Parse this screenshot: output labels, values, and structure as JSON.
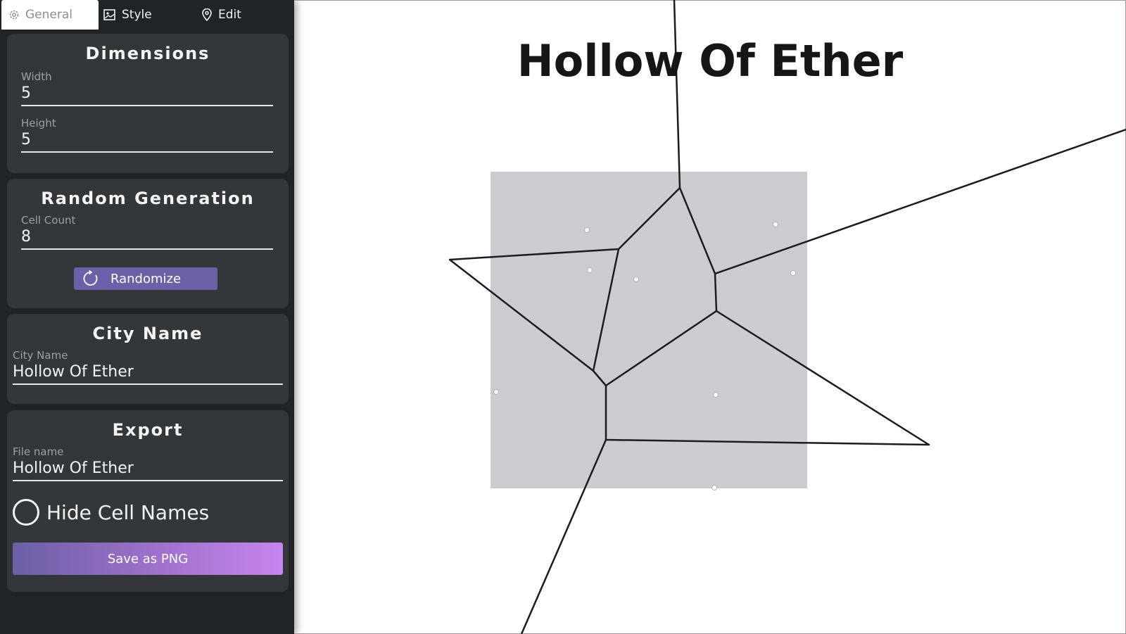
{
  "tabs": [
    {
      "label": "General",
      "icon": "gear-icon",
      "active": true
    },
    {
      "label": "Style",
      "icon": "image-icon",
      "active": false
    },
    {
      "label": "Edit",
      "icon": "map-pin-icon",
      "active": false
    }
  ],
  "dimensions": {
    "title": "Dimensions",
    "width_label": "Width",
    "width_value": "5",
    "height_label": "Height",
    "height_value": "5"
  },
  "random": {
    "title": "Random Generation",
    "cell_count_label": "Cell Count",
    "cell_count_value": "8",
    "randomize_label": "Randomize"
  },
  "city": {
    "title": "City Name",
    "label": "City Name",
    "value": "Hollow Of Ether"
  },
  "export": {
    "title": "Export",
    "file_label": "File name",
    "file_value": "Hollow Of Ether",
    "hide_names_label": "Hide Cell Names",
    "hide_names_checked": false,
    "save_label": "Save as PNG"
  },
  "map": {
    "title": "Hollow Of Ether"
  },
  "colors": {
    "sidebar_bg": "#202427",
    "card_bg": "#33373a",
    "accent": "#6a61a8",
    "gradient_end": "#c684ef",
    "map_region": "#cbcccf"
  }
}
